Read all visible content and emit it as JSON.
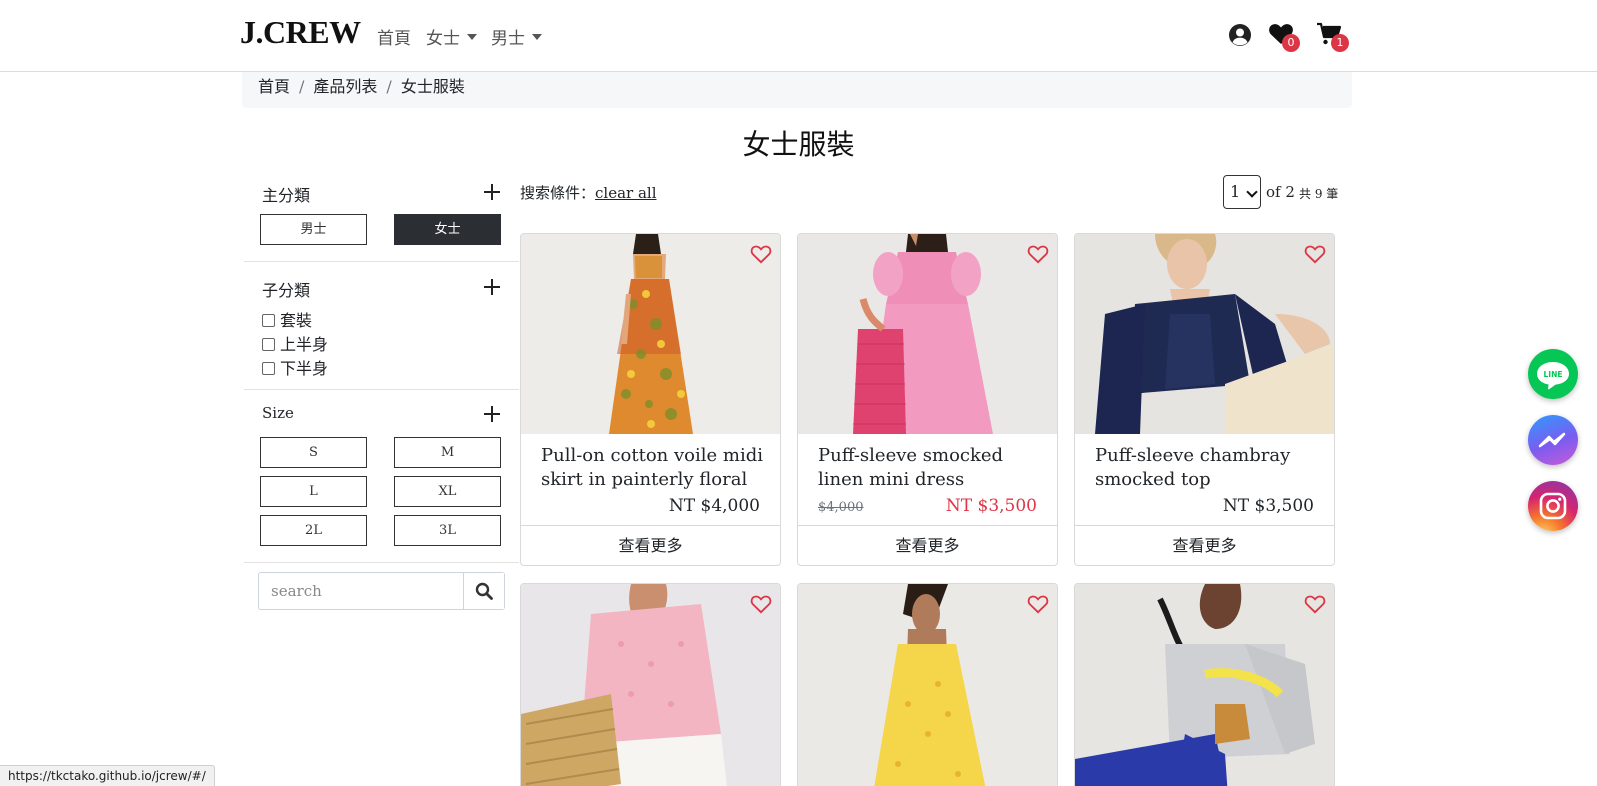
{
  "navbar": {
    "brand": "J.CREW",
    "links": {
      "home": "首頁",
      "women": "女士",
      "men": "男士"
    },
    "wishlist_count": "0",
    "cart_count": "1",
    "badge_color": "#dc3545"
  },
  "breadcrumb": {
    "home": "首頁",
    "products": "產品列表",
    "current": "女士服裝",
    "separator": "/"
  },
  "page_title": "女士服裝",
  "sidebar": {
    "main_category": {
      "title": "主分類",
      "options": [
        "男士",
        "女士"
      ],
      "selected": "女士"
    },
    "sub_category": {
      "title": "子分類",
      "options": [
        "套裝",
        "上半身",
        "下半身"
      ]
    },
    "size": {
      "title": "Size",
      "options": [
        "S",
        "M",
        "L",
        "XL",
        "2L",
        "3L"
      ]
    },
    "search": {
      "placeholder": "search"
    }
  },
  "filters": {
    "label": "搜索條件：",
    "clear_label": "clear all"
  },
  "pagination": {
    "current": "1",
    "of_label": "of 2",
    "total_label": "共 9 筆"
  },
  "products": [
    {
      "name": "Pull-on cotton voile midi skirt in painterly floral",
      "price": "NT $4,000",
      "original_price": null,
      "more_label": "查看更多"
    },
    {
      "name": "Puff-sleeve smocked linen mini dress",
      "price": "NT $3,500",
      "original_price": "$4,000",
      "more_label": "查看更多"
    },
    {
      "name": "Puff-sleeve chambray smocked top",
      "price": "NT $3,500",
      "original_price": null,
      "more_label": "查看更多"
    },
    {
      "name": "",
      "price": "",
      "original_price": null,
      "more_label": ""
    },
    {
      "name": "",
      "price": "",
      "original_price": null,
      "more_label": ""
    },
    {
      "name": "",
      "price": "",
      "original_price": null,
      "more_label": ""
    }
  ],
  "floating": {
    "line_label": "LINE",
    "line_color": "#06c755",
    "messenger_color": "#7b5cf0",
    "instagram_color": "#c13584"
  },
  "status_bar_url": "https://tkctako.github.io/jcrew/#/"
}
